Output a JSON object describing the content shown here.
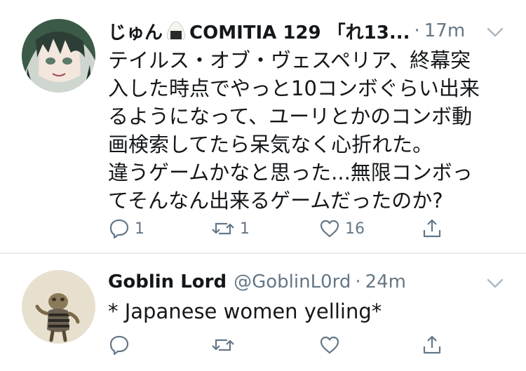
{
  "tweets": [
    {
      "display_name": "じゅん",
      "display_name_suffix": "COMITIA 129 「れ13...",
      "display_name_icon": "onigiri-icon",
      "handle": "",
      "separator": "·",
      "time": "17m",
      "body_lines": [
        "テイルス・オブ・ヴェスペリア、終幕突",
        "入した時点でやっと10コンボぐらい出来",
        "るようになって、ユーリとかのコンボ動",
        "画検索してたら呆気なく心折れた。",
        "違うゲームかなと思った...無限コンボっ",
        "てそんなん出来るゲームだったのか?"
      ],
      "actions": {
        "reply_count": "1",
        "retweet_count": "1",
        "like_count": "16"
      }
    },
    {
      "display_name": "Goblin Lord",
      "handle": "@GoblinL0rd",
      "separator": "·",
      "time": "24m",
      "body_lines": [
        "* Japanese women yelling*"
      ],
      "actions": {
        "reply_count": "",
        "retweet_count": "",
        "like_count": ""
      }
    }
  ],
  "colors": {
    "text_primary": "#14171a",
    "text_secondary": "#657786",
    "divider": "#e6ecf0",
    "background": "#ffffff"
  }
}
